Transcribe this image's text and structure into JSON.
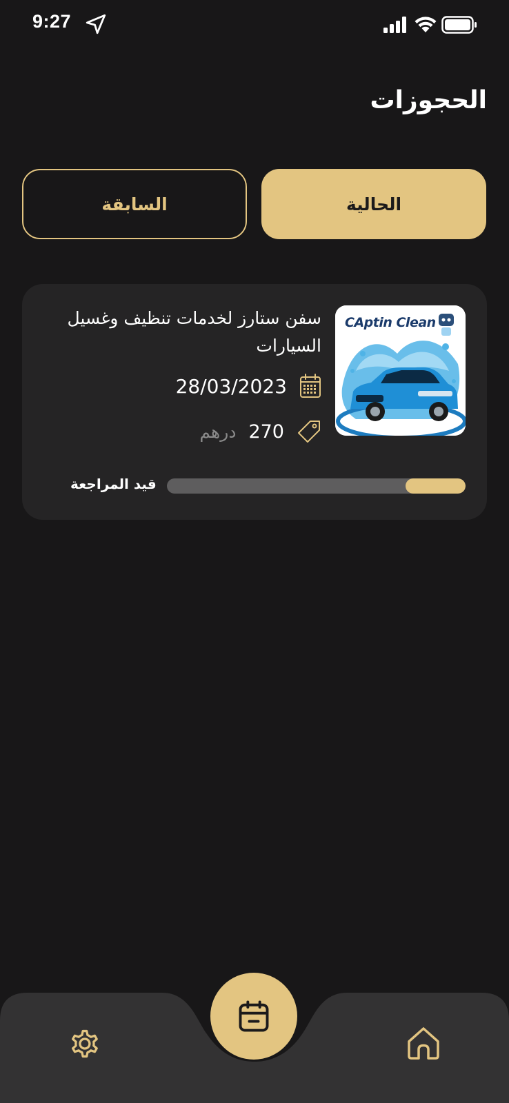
{
  "status_bar": {
    "time": "9:27",
    "icons": [
      "location-arrow-icon",
      "cellular-signal-icon",
      "wifi-icon",
      "battery-icon"
    ]
  },
  "header": {
    "title": "الحجوزات"
  },
  "tabs": [
    {
      "label": "الحالية",
      "active": true
    },
    {
      "label": "السابقة",
      "active": false
    }
  ],
  "bookings": [
    {
      "title": "سفن ستارز لخدمات تنظيف وغسيل السيارات",
      "thumbnail_logo": "CAptin Clean",
      "date": "28/03/2023",
      "price": "270",
      "currency": "درهم",
      "status": "قيد المراجعة",
      "progress": 0.2
    }
  ],
  "bottom_nav": {
    "items": [
      "settings-icon",
      "bookings-calendar-icon",
      "home-icon"
    ],
    "active": "bookings-calendar-icon"
  },
  "colors": {
    "background": "#181718",
    "accent": "#e3c581",
    "card": "#252425",
    "nav": "#333233",
    "muted_text": "#8a8a8a",
    "progress_track": "#5e5d5e"
  }
}
